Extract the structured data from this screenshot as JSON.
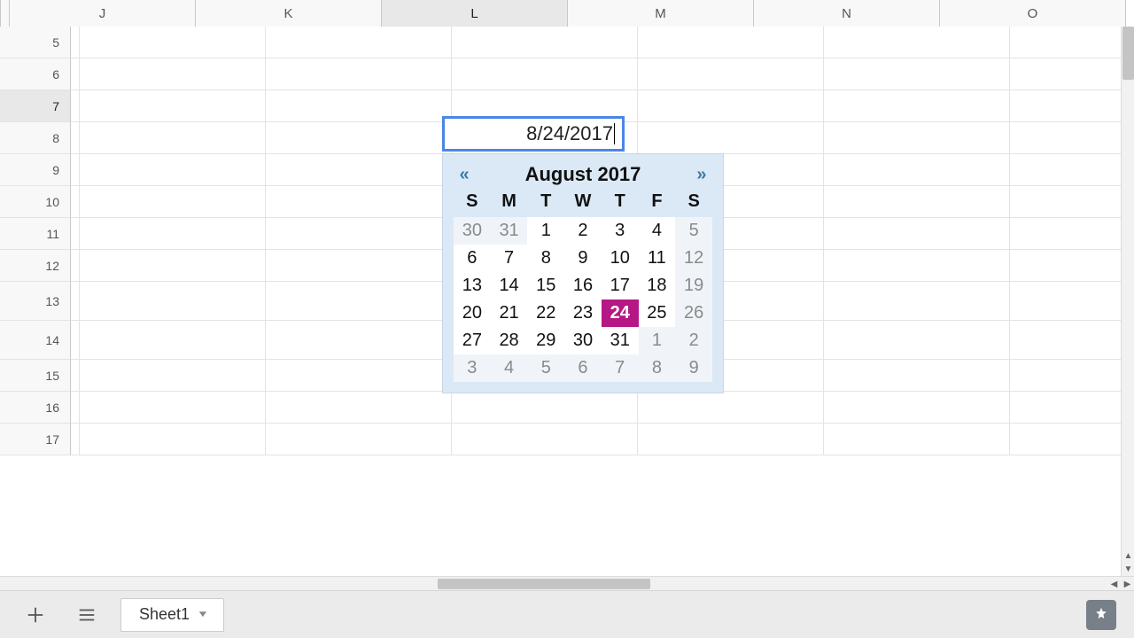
{
  "columns": [
    "J",
    "K",
    "L",
    "M",
    "N",
    "O"
  ],
  "selected_column": "L",
  "rows": [
    5,
    6,
    7,
    8,
    9,
    10,
    11,
    12,
    13,
    14,
    15,
    16,
    17
  ],
  "selected_row": 7,
  "active_cell": {
    "ref": "L7",
    "value": "8/24/2017"
  },
  "datepicker": {
    "title": "August 2017",
    "prev_label": "«",
    "next_label": "»",
    "day_headers": [
      "S",
      "M",
      "T",
      "W",
      "T",
      "F",
      "S"
    ],
    "weeks": [
      [
        {
          "n": 30,
          "dim": true
        },
        {
          "n": 31,
          "dim": true
        },
        {
          "n": 1
        },
        {
          "n": 2
        },
        {
          "n": 3
        },
        {
          "n": 4
        },
        {
          "n": 5,
          "dim": true
        }
      ],
      [
        {
          "n": 6
        },
        {
          "n": 7
        },
        {
          "n": 8
        },
        {
          "n": 9
        },
        {
          "n": 10
        },
        {
          "n": 11
        },
        {
          "n": 12,
          "dim": true
        }
      ],
      [
        {
          "n": 13
        },
        {
          "n": 14
        },
        {
          "n": 15
        },
        {
          "n": 16
        },
        {
          "n": 17
        },
        {
          "n": 18
        },
        {
          "n": 19,
          "dim": true
        }
      ],
      [
        {
          "n": 20
        },
        {
          "n": 21
        },
        {
          "n": 22
        },
        {
          "n": 23
        },
        {
          "n": 24,
          "selected": true
        },
        {
          "n": 25
        },
        {
          "n": 26,
          "dim": true
        }
      ],
      [
        {
          "n": 27
        },
        {
          "n": 28
        },
        {
          "n": 29
        },
        {
          "n": 30
        },
        {
          "n": 31
        },
        {
          "n": 1,
          "dim": true
        },
        {
          "n": 2,
          "dim": true
        }
      ],
      [
        {
          "n": 3,
          "dim": true
        },
        {
          "n": 4,
          "dim": true
        },
        {
          "n": 5,
          "dim": true
        },
        {
          "n": 6,
          "dim": true
        },
        {
          "n": 7,
          "dim": true
        },
        {
          "n": 8,
          "dim": true
        },
        {
          "n": 9,
          "dim": true
        }
      ]
    ]
  },
  "sheetbar": {
    "sheet_name": "Sheet1"
  }
}
